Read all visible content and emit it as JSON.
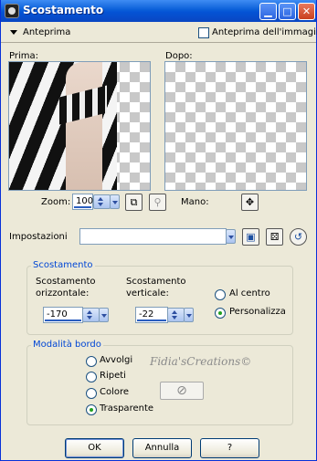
{
  "window": {
    "title": "Scostamento"
  },
  "preview_section": {
    "toggle_label": "Anteprima",
    "image_preview_label": "Anteprima dell'immagine",
    "image_preview_checked": false,
    "before_label": "Prima:",
    "after_label": "Dopo:"
  },
  "zoom": {
    "label": "Zoom:",
    "value": "100"
  },
  "hand": {
    "label": "Mano:"
  },
  "settings": {
    "label": "Impostazioni",
    "value": ""
  },
  "offset": {
    "group_label": "Scostamento",
    "horizontal_label_1": "Scostamento",
    "horizontal_label_2": "orizzontale:",
    "horizontal_value": "-170",
    "vertical_label_1": "Scostamento",
    "vertical_label_2": "verticale:",
    "vertical_value": "-22",
    "center_label": "Al centro",
    "custom_label": "Personalizza",
    "selected": "Personalizza"
  },
  "edge_mode": {
    "group_label": "Modalità bordo",
    "options": [
      "Avvolgi",
      "Ripeti",
      "Colore",
      "Trasparente"
    ],
    "selected": "Trasparente"
  },
  "watermark": "Fidia'sCreations©",
  "buttons": {
    "ok": "OK",
    "cancel": "Annulla",
    "help": "?"
  }
}
